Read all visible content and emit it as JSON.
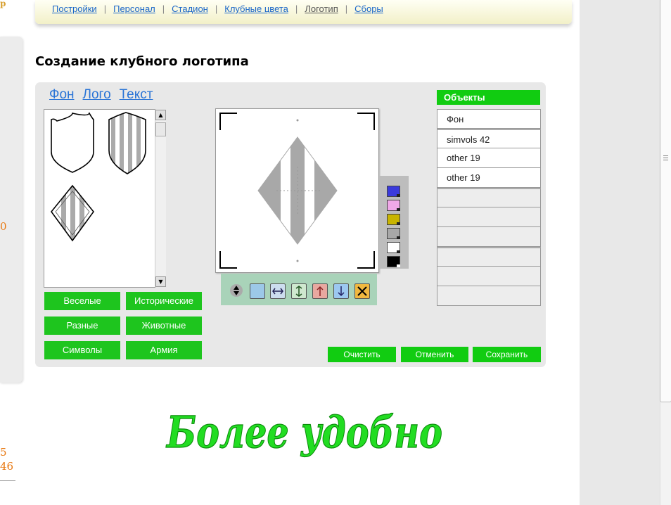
{
  "nav": {
    "items": [
      {
        "label": "Постройки"
      },
      {
        "label": "Персонал"
      },
      {
        "label": "Стадион"
      },
      {
        "label": "Клубные цвета"
      },
      {
        "label": "Логотип"
      },
      {
        "label": "Сборы"
      }
    ],
    "separator": "|",
    "current": "Логотип"
  },
  "page_title": "Создание клубного логотипа",
  "editor": {
    "tabs": [
      "Фон",
      "Лого",
      "Текст"
    ],
    "categories": [
      "Веселые",
      "Исторические",
      "Разные",
      "Животные",
      "Символы",
      "Армия"
    ],
    "objects": {
      "header": "Объекты",
      "items": [
        "Фон",
        "simvols 42",
        "other 19",
        "other 19"
      ]
    },
    "palette_colors": [
      "#3a3adc",
      "#f0a8e8",
      "#c8b400",
      "#a8a8a8",
      "#ffffff",
      "#000000"
    ],
    "toolbar_icons": [
      "layer-order-icon",
      "fill-square-icon",
      "flip-horizontal-icon",
      "flip-vertical-icon",
      "move-up-icon",
      "move-down-icon",
      "delete-icon"
    ],
    "actions": {
      "clear": "Очистить",
      "cancel": "Отменить",
      "save": "Сохранить"
    }
  },
  "slogan": "Более удобно",
  "left_fragments": {
    "top": "р",
    "mid": "0",
    "low1": "5",
    "low2": "46"
  },
  "colors": {
    "accent_green": "#11cc11",
    "link_blue": "#1a66c8"
  }
}
